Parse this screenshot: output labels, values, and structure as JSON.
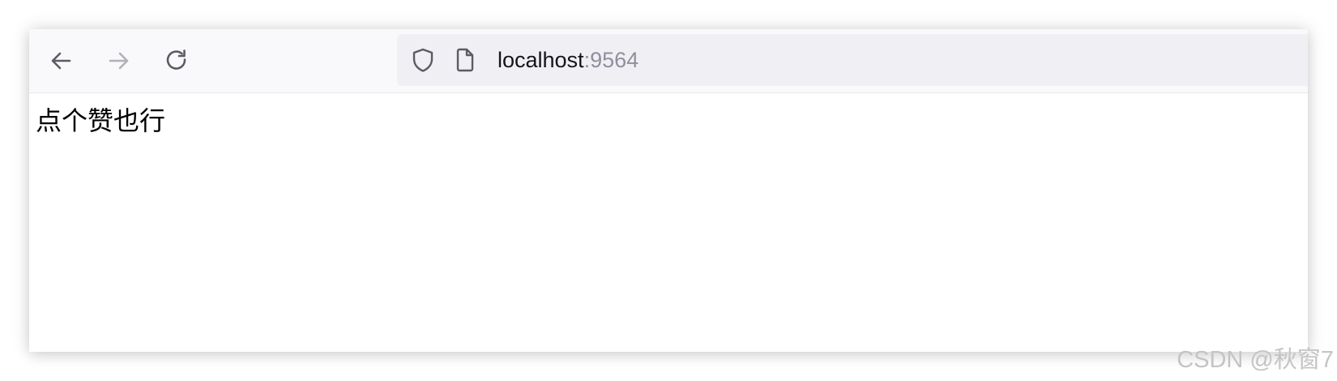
{
  "browser": {
    "colors": {
      "toolbar_bg": "#f9f9fb",
      "urlbar_bg": "#f0f0f4",
      "icon_active": "#5b5b66",
      "icon_disabled": "#b1b1b8",
      "port_text": "#8f8f9d"
    },
    "nav": {
      "back_icon": "arrow-left-icon",
      "forward_icon": "arrow-right-icon",
      "forward_enabled": false,
      "reload_icon": "reload-icon"
    },
    "urlbar": {
      "shield_icon": "shield-icon",
      "page_icon": "page-icon",
      "host": "localhost",
      "port": ":9564"
    }
  },
  "page": {
    "text": "点个赞也行"
  },
  "watermark": {
    "text": "CSDN @秋窗7"
  }
}
